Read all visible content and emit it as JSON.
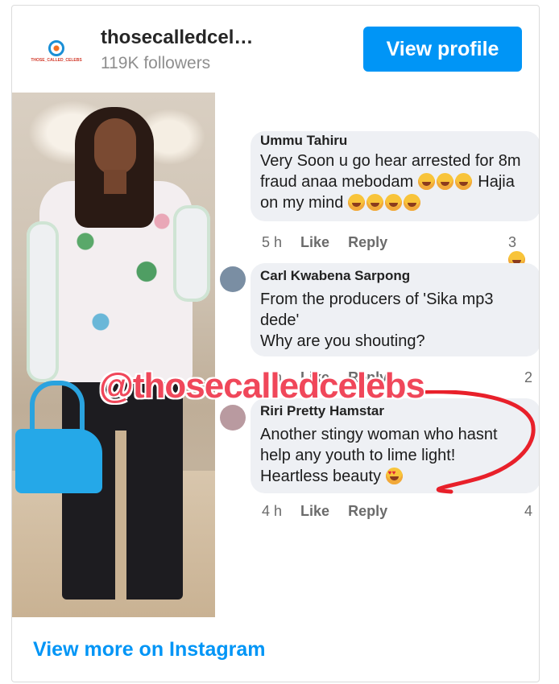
{
  "header": {
    "username": "thosecalledcel…",
    "followers": "119K followers",
    "view_profile_label": "View profile",
    "avatar_logo_text": "THOSE_CALLED_CELEBS"
  },
  "post": {
    "watermark": "@thosecalledcelebs",
    "comments": [
      {
        "name": "Ummu Tahiru",
        "lines": [
          "Very Soon u go hear arrested for 8m",
          "fraud anaa mebodam",
          "on my mind"
        ],
        "line2_suffix": "Hajia",
        "time": "5 h",
        "like": "Like",
        "reply": "Reply",
        "reactions": "3"
      },
      {
        "name": "Carl Kwabena Sarpong",
        "lines": [
          "From the producers of 'Sika mp3",
          "dede'",
          "Why are you shouting?"
        ],
        "time": "5 h",
        "like": "Like",
        "reply": "Reply",
        "reactions": "2"
      },
      {
        "name": "Riri Pretty Hamstar",
        "lines": [
          "Another stingy woman who hasnt",
          "help any youth to lime light!",
          "Heartless beauty"
        ],
        "time": "4 h",
        "like": "Like",
        "reply": "Reply",
        "reactions": "4"
      }
    ]
  },
  "footer": {
    "view_more_label": "View more on Instagram"
  },
  "colors": {
    "accent": "#0095f6",
    "watermark": "#f0475a",
    "annotation": "#e8202a"
  }
}
